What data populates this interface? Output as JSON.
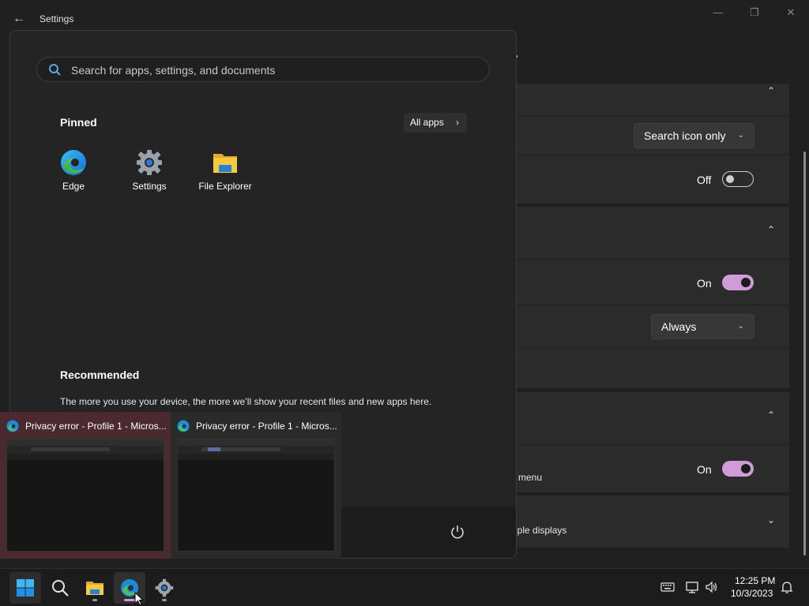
{
  "window": {
    "title": "Settings",
    "back_icon": "back-arrow-icon",
    "controls": [
      "minimize-icon",
      "maximize-icon",
      "close-icon"
    ]
  },
  "settings_panel": {
    "search_mode_dropdown": "Search icon only",
    "toggle_1": {
      "state_label": "Off",
      "on": false
    },
    "toggle_2": {
      "state_label": "On",
      "on": true
    },
    "always_dropdown": "Always",
    "toggle_3": {
      "state_label": "On",
      "on": true
    },
    "partial_menu_text": "menu",
    "partial_displays_text": "iple displays"
  },
  "start_menu": {
    "search_placeholder": "Search for apps, settings, and documents",
    "pinned_title": "Pinned",
    "all_apps_label": "All apps",
    "pinned_apps": [
      {
        "label": "Edge",
        "icon": "edge-icon"
      },
      {
        "label": "Settings",
        "icon": "settings-gear-icon"
      },
      {
        "label": "File Explorer",
        "icon": "folder-icon"
      }
    ],
    "recommended_title": "Recommended",
    "recommended_text": "The more you use your device, the more we’ll show your recent files and new apps here.",
    "power_icon": "power-icon"
  },
  "thumbnails": [
    {
      "title": "Privacy error - Profile 1 - Micros...",
      "icon": "edge-icon",
      "active": true
    },
    {
      "title": "Privacy error - Profile 1 - Micros...",
      "icon": "edge-icon",
      "active": false
    }
  ],
  "taskbar": {
    "items": [
      "windows-start-icon",
      "search-icon",
      "file-explorer-icon",
      "edge-icon",
      "settings-gear-icon"
    ],
    "tray_icons": [
      "keyboard-icon",
      "network-icon",
      "volume-icon",
      "notification-bell-icon"
    ],
    "time": "12:25 PM",
    "date": "10/3/2023"
  },
  "colors": {
    "accent": "#d09bd8",
    "background": "#202020",
    "card": "#2b2b2b",
    "start_menu": "#242424",
    "taskbar": "#1c1c1c"
  }
}
